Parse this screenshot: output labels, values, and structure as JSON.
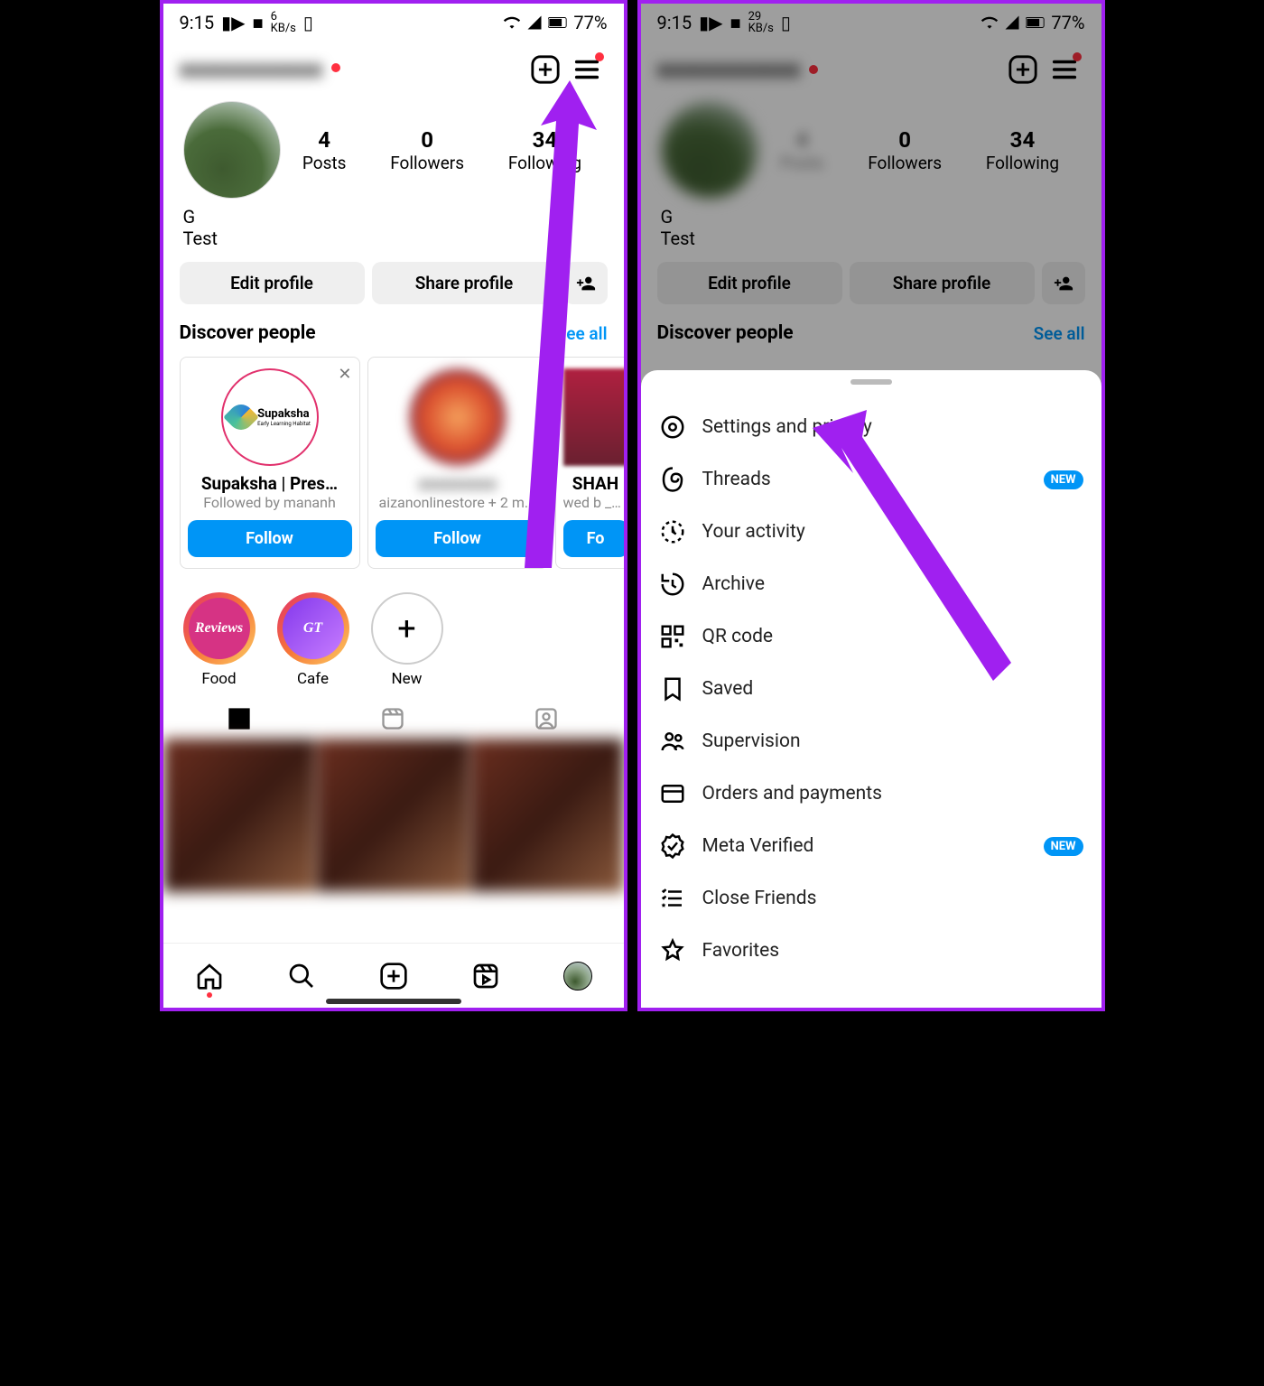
{
  "status": {
    "time": "9:15",
    "kbps_left": "6",
    "kbps_right": "29",
    "kbps_label": "KB/s",
    "battery": "77%"
  },
  "header": {
    "username": "xxxxxxxxxxxx"
  },
  "stats": {
    "posts": {
      "num": "4",
      "label": "Posts"
    },
    "followers": {
      "num": "0",
      "label": "Followers"
    },
    "following": {
      "num": "34",
      "label": "Following"
    }
  },
  "bio": {
    "name": "G",
    "text": "Test"
  },
  "buttons": {
    "edit": "Edit profile",
    "share": "Share profile"
  },
  "discover": {
    "title": "Discover people",
    "seeall": "See all"
  },
  "cards": {
    "c1": {
      "name": "Supaksha | Pres…",
      "sub": "Followed by mananh",
      "logo": "Supaksha",
      "logo_sub": "Early Learning Habitat",
      "follow": "Follow"
    },
    "c2": {
      "name": "xxxxxxxxx",
      "sub": "aizanonlinestore + 2 m...",
      "follow": "Follow"
    },
    "c3": {
      "name": "SHAH",
      "sub": "wed b  _by_naj",
      "follow": "Fo"
    }
  },
  "highlights": {
    "h1": {
      "label": "Food",
      "text": "Reviews"
    },
    "h2": {
      "label": "Cafe",
      "text": "GT"
    },
    "h3": {
      "label": "New",
      "plus": "+"
    }
  },
  "menu": {
    "settings": "Settings and privacy",
    "threads": "Threads",
    "activity": "Your activity",
    "archive": "Archive",
    "qr": "QR code",
    "saved": "Saved",
    "supervision": "Supervision",
    "orders": "Orders and payments",
    "verified": "Meta Verified",
    "close_friends": "Close Friends",
    "favorites": "Favorites",
    "new_badge": "NEW"
  }
}
